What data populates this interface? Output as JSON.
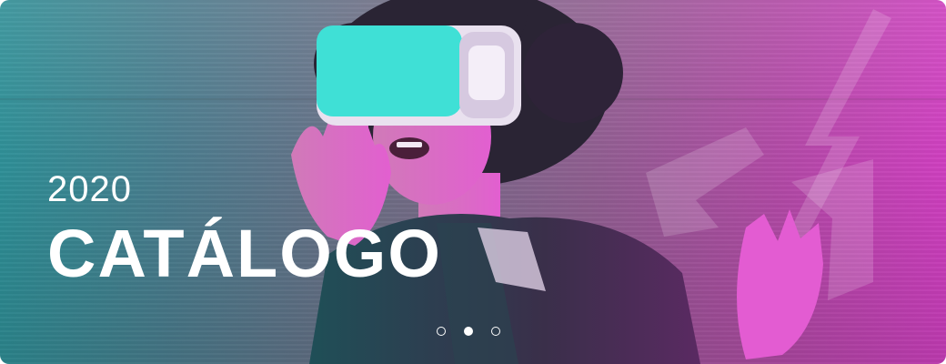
{
  "banner": {
    "year": "2020",
    "title": "CATÁLOGO",
    "slides": [
      {
        "active": false
      },
      {
        "active": true
      },
      {
        "active": false
      }
    ]
  },
  "colors": {
    "gradient_left": "#2e8f97",
    "gradient_right": "#cf3fc0",
    "headset": "#3fe0d6",
    "text": "#ffffff"
  },
  "icons": {
    "brand_mark": "arrow-logo-mark",
    "slide_indicator": "carousel-dot"
  }
}
